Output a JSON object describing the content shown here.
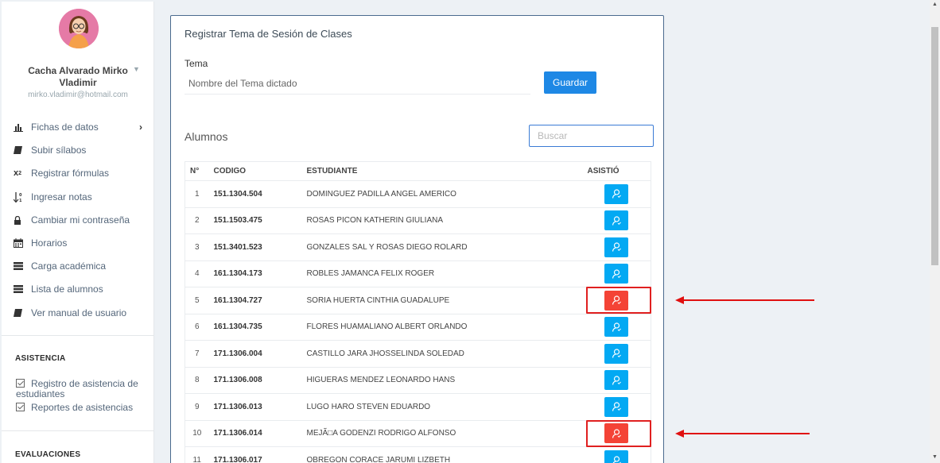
{
  "sidebar": {
    "user_name": "Cacha Alvarado Mirko Vladimir",
    "user_email": "mirko.vladimir@hotmail.com",
    "menu": [
      {
        "label": "Fichas de datos",
        "icon": "bar-chart-icon"
      },
      {
        "label": "Subir sílabos",
        "icon": "book-icon"
      },
      {
        "label": "Registrar fórmulas",
        "icon": "subscript-icon"
      },
      {
        "label": "Ingresar notas",
        "icon": "sort-numeric-icon"
      },
      {
        "label": "Cambiar mi contraseña",
        "icon": "lock-icon"
      },
      {
        "label": "Horarios",
        "icon": "calendar-icon"
      },
      {
        "label": "Carga académica",
        "icon": "list-icon"
      },
      {
        "label": "Lista de alumnos",
        "icon": "list-icon"
      },
      {
        "label": "Ver manual de usuario",
        "icon": "book-icon"
      }
    ],
    "section_asistencia": "ASISTENCIA",
    "asistencia_items": [
      "Registro de asistencia de estudiantes",
      "Reportes de asistencias"
    ],
    "section_evaluaciones": "EVALUACIONES"
  },
  "panel": {
    "title": "Registrar Tema de Sesión de Clases",
    "tema_label": "Tema",
    "tema_placeholder": "Nombre del Tema dictado",
    "save_label": "Guardar",
    "alumnos_title": "Alumnos",
    "search_placeholder": "Buscar"
  },
  "table": {
    "headers": [
      "N°",
      "CODIGO",
      "ESTUDIANTE",
      "ASISTIÓ"
    ],
    "rows": [
      {
        "n": "1",
        "code": "151.1304.504",
        "name": "DOMINGUEZ PADILLA ANGEL AMERICO",
        "present": true
      },
      {
        "n": "2",
        "code": "151.1503.475",
        "name": "ROSAS PICON KATHERIN GIULIANA",
        "present": true
      },
      {
        "n": "3",
        "code": "151.3401.523",
        "name": "GONZALES SAL Y ROSAS DIEGO ROLARD",
        "present": true
      },
      {
        "n": "4",
        "code": "161.1304.173",
        "name": "ROBLES JAMANCA FELIX ROGER",
        "present": true
      },
      {
        "n": "5",
        "code": "161.1304.727",
        "name": "SORIA HUERTA CINTHIA GUADALUPE",
        "present": false
      },
      {
        "n": "6",
        "code": "161.1304.735",
        "name": "FLORES HUAMALIANO ALBERT ORLANDO",
        "present": true
      },
      {
        "n": "7",
        "code": "171.1306.004",
        "name": "CASTILLO JARA JHOSSELINDA SOLEDAD",
        "present": true
      },
      {
        "n": "8",
        "code": "171.1306.008",
        "name": "HIGUERAS MENDEZ LEONARDO HANS",
        "present": true
      },
      {
        "n": "9",
        "code": "171.1306.013",
        "name": "LUGO HARO STEVEN EDUARDO",
        "present": true
      },
      {
        "n": "10",
        "code": "171.1306.014",
        "name": "MEJÃ□A GODENZI RODRIGO ALFONSO",
        "present": false
      },
      {
        "n": "11",
        "code": "171.1306.017",
        "name": "OBREGON CORACE JARUMI LIZBETH",
        "present": true
      }
    ]
  },
  "colors": {
    "present": "#03a9f3",
    "absent": "#f44336",
    "primary": "#1e88e5",
    "annotation": "#e01010"
  }
}
